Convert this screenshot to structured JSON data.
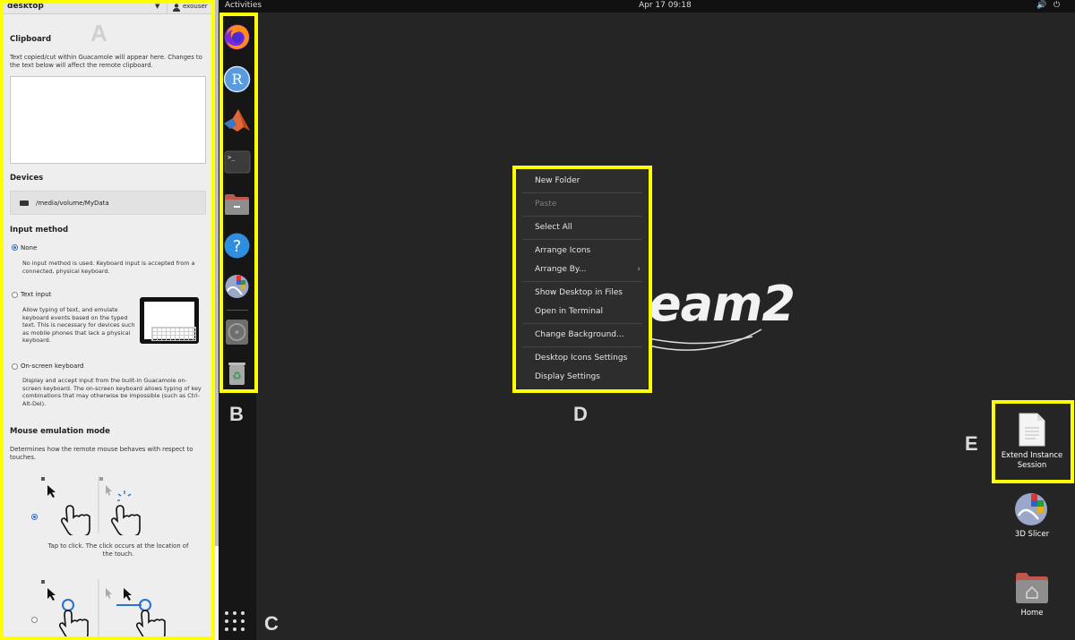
{
  "guac_panel": {
    "connection_name": "desktop",
    "user": "exouser",
    "callout": "A",
    "clipboard": {
      "title": "Clipboard",
      "description": "Text copied/cut within Guacamole will appear here. Changes to the text below will affect the remote clipboard.",
      "value": ""
    },
    "devices": {
      "title": "Devices",
      "path": "/media/volume/MyData"
    },
    "input_method": {
      "title": "Input method",
      "selected": "None",
      "options": [
        {
          "label": "None",
          "description": "No input method is used. Keyboard input is accepted from a connected, physical keyboard."
        },
        {
          "label": "Text input",
          "description": "Allow typing of text, and emulate keyboard events based on the typed text. This is necessary for devices such as mobile phones that lack a physical keyboard."
        },
        {
          "label": "On-screen keyboard",
          "description": "Display and accept input from the built-in Guacamole on-screen keyboard. The on-screen keyboard allows typing of key combinations that may otherwise be impossible (such as Ctrl-Alt-Del)."
        }
      ]
    },
    "mouse_mode": {
      "title": "Mouse emulation mode",
      "description": "Determines how the remote mouse behaves with respect to touches.",
      "selected_index": 0,
      "modes": [
        {
          "caption": "Tap to click. The click occurs at the location of the touch."
        },
        {
          "caption": ""
        }
      ]
    }
  },
  "desktop": {
    "activities": "Activities",
    "clock": "Apr 17  09:18",
    "volume_icon": "speaker-icon",
    "power_icon": "power-icon",
    "wallpaper_text": "eam2",
    "dock": {
      "callout_b": "B",
      "callout_c": "C",
      "apps": [
        {
          "name": "firefox-icon",
          "color": "#ff7139"
        },
        {
          "name": "r-icon",
          "color": "#4a8fdc",
          "glyph": "R"
        },
        {
          "name": "matlab-icon",
          "color": "#e16737"
        },
        {
          "name": "terminal-icon",
          "color": "#3a3a3a",
          "glyph": ">_"
        },
        {
          "name": "files-icon",
          "color": "#b5544b"
        },
        {
          "name": "help-icon",
          "color": "#2e8ee0",
          "glyph": "?"
        },
        {
          "name": "slicer-icon",
          "color": "#9aa7c8"
        },
        {
          "name": "disc-icon",
          "color": "#777777"
        },
        {
          "name": "trash-icon",
          "color": "#8a8a8a",
          "glyph": "♻"
        }
      ]
    },
    "context_menu": {
      "callout": "D",
      "groups": [
        [
          {
            "label": "New Folder",
            "enabled": true
          }
        ],
        [
          {
            "label": "Paste",
            "enabled": false
          }
        ],
        [
          {
            "label": "Select All",
            "enabled": true
          }
        ],
        [
          {
            "label": "Arrange Icons",
            "enabled": true
          },
          {
            "label": "Arrange By...",
            "enabled": true,
            "submenu": true
          }
        ],
        [
          {
            "label": "Show Desktop in Files",
            "enabled": true
          },
          {
            "label": "Open in Terminal",
            "enabled": true
          }
        ],
        [
          {
            "label": "Change Background...",
            "enabled": true
          }
        ],
        [
          {
            "label": "Desktop Icons Settings",
            "enabled": true
          },
          {
            "label": "Display Settings",
            "enabled": true
          }
        ]
      ]
    },
    "icons": {
      "callout": "E",
      "extend": "Extend Instance Session",
      "slicer": "3D Slicer",
      "home": "Home"
    },
    "highlight_color": "#ffff00"
  }
}
